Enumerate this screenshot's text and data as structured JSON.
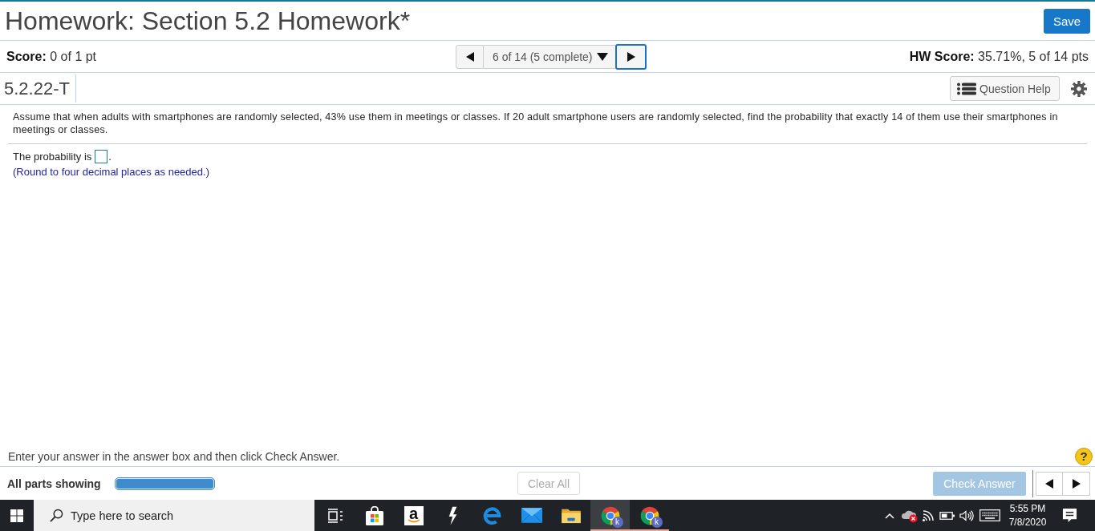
{
  "header": {
    "title": "Homework: Section 5.2 Homework*",
    "save_button": "Save"
  },
  "score_bar": {
    "score": "**Score:** 0 of 1 pt",
    "navigator": {
      "prev": {
        "focused": false
      },
      "selector": "6 of 14 (5 complete)",
      "next": {
        "focused": true
      }
    },
    "hw_score": "**HW Score:** 35.71%, 5 of 14 pts"
  },
  "question_bar": {
    "id": "5.2.22-T",
    "help_button": "Question Help"
  },
  "question": {
    "text": "Assume that when adults with smartphones are randomly selected, 43% use them in meetings or classes. If 20 adult smartphone users are randomly selected, find the probability that exactly 14 of them use their smartphones in meetings or classes.",
    "answer_prompt": "The probability is",
    "answer_suffix": ".",
    "hint": "(Round to four decimal places as needed.)"
  },
  "footer": {
    "instruction": "Enter your answer in the answer box and then click Check Answer.",
    "help_glyph": "?",
    "parts_label": "All parts showing",
    "parts_progress": {
      "level": 1
    },
    "clear_button": {
      "label": "Clear All",
      "disabled": true
    },
    "check_button": {
      "label": "Check Answer",
      "disabled": true
    }
  },
  "taskbar": {
    "search": {
      "placeholder": "Type here to search"
    },
    "apps": [
      {
        "kind": "task-view",
        "running": false,
        "active": false
      },
      {
        "kind": "store",
        "running": false,
        "active": false
      },
      {
        "kind": "amazon",
        "glyph": "a",
        "running": false,
        "active": false
      },
      {
        "kind": "bolt",
        "running": false,
        "active": false
      },
      {
        "kind": "edge",
        "running": false,
        "active": false
      },
      {
        "kind": "mail",
        "running": false,
        "active": false
      },
      {
        "kind": "folder",
        "running": false,
        "active": false
      },
      {
        "kind": "chrome",
        "badge": "k",
        "running": true,
        "active": true
      },
      {
        "kind": "chrome",
        "badge": "k",
        "running": true,
        "active": false
      }
    ],
    "tray": [
      {
        "kind": "chevron"
      },
      {
        "kind": "cloud-error"
      },
      {
        "kind": "wifi"
      },
      {
        "kind": "battery"
      },
      {
        "kind": "volume"
      },
      {
        "kind": "keyboard"
      }
    ],
    "clock": {
      "time": "5:55 PM",
      "date": "7/8/2020"
    }
  }
}
